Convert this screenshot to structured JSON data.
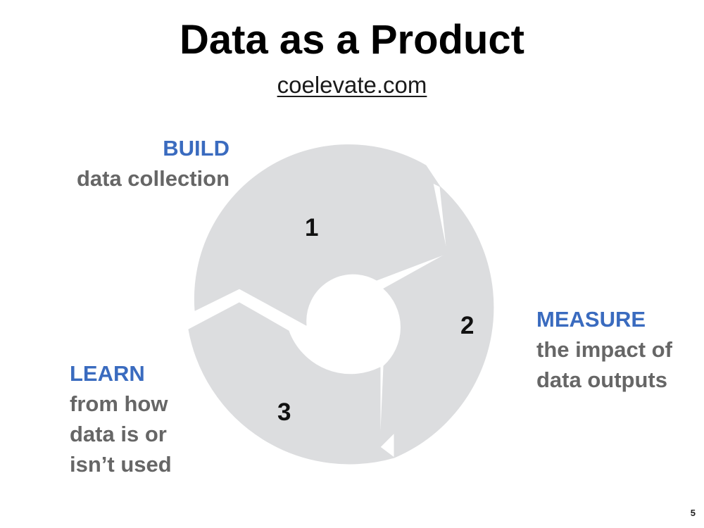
{
  "slide": {
    "title": "Data as a Product",
    "subtitle_link": "coelevate.com",
    "page_number": "5"
  },
  "cycle": {
    "fill_color": "#dcdddf",
    "heading_color": "#3a6bbf",
    "desc_color": "#666666",
    "steps": [
      {
        "number": "1",
        "heading": "BUILD",
        "description": "data collection"
      },
      {
        "number": "2",
        "heading": "MEASURE",
        "description": "the impact of\ndata outputs"
      },
      {
        "number": "3",
        "heading": "LEARN",
        "description": "from how\ndata is or\nisn’t used"
      }
    ]
  }
}
